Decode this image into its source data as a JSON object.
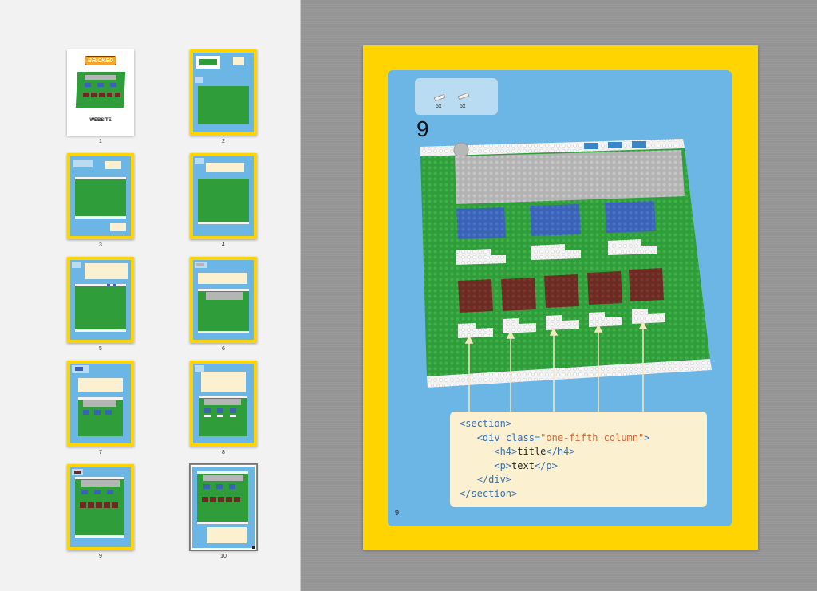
{
  "sidebar": {
    "pages": [
      {
        "label": "1",
        "cover_brand": "BRICKED",
        "cover_title": "WEBSITE"
      },
      {
        "label": "2"
      },
      {
        "label": "3"
      },
      {
        "label": "4"
      },
      {
        "label": "5"
      },
      {
        "label": "6"
      },
      {
        "label": "7"
      },
      {
        "label": "8"
      },
      {
        "label": "9"
      },
      {
        "label": "10"
      }
    ],
    "selected": "10"
  },
  "main": {
    "step_number": "9",
    "page_number": "9",
    "parts": [
      {
        "qty": "5x",
        "name": "white 1x2 plate"
      },
      {
        "qty": "5x",
        "name": "white 1x2 plate"
      }
    ],
    "code": {
      "line1": {
        "tag": "<section>"
      },
      "line2": {
        "open": "<div ",
        "attr": "class=",
        "value": "\"one-fifth column\"",
        "close": ">"
      },
      "line3": {
        "open": "<h4>",
        "text": "title",
        "close": "</h4>"
      },
      "line4": {
        "open": "<p>",
        "text": "text",
        "close": "</p>"
      },
      "line5": {
        "tag": "</div>"
      },
      "line6": {
        "tag": "</section>"
      }
    }
  },
  "colors": {
    "page_border": "#ffd400",
    "page_bg": "#6cb6e6",
    "baseplate": "#2f9e3a",
    "gray_plate": "#b5b5b5",
    "blue_tile": "#3a63b8",
    "brown_tile": "#6b2b22",
    "code_bg": "#fbf0d0",
    "code_tag": "#3a6fb0",
    "code_string": "#d16a3a"
  }
}
